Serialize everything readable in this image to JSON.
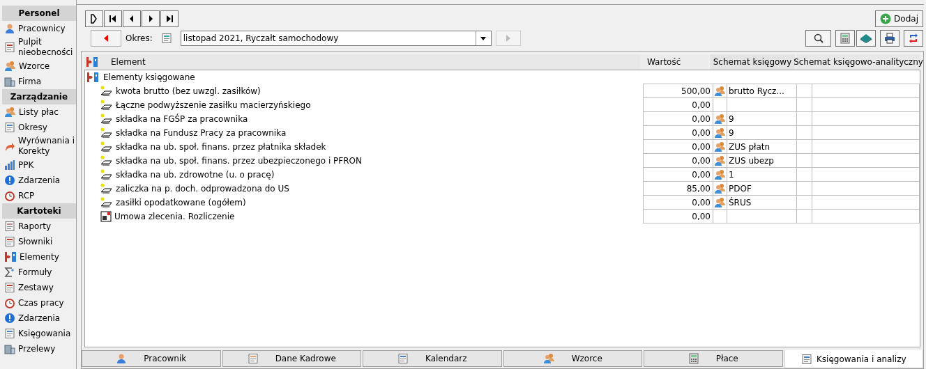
{
  "sidebar": [
    {
      "heading": "Personel",
      "items": [
        {
          "label": "Pracownicy"
        },
        {
          "label": "Pulpit nieobecności"
        },
        {
          "label": "Wzorce"
        },
        {
          "label": "Firma"
        }
      ]
    },
    {
      "heading": "Zarządzanie",
      "items": [
        {
          "label": "Listy płac"
        },
        {
          "label": "Okresy"
        },
        {
          "label": "Wyrównania i Korekty"
        },
        {
          "label": "PPK"
        },
        {
          "label": "Zdarzenia"
        },
        {
          "label": "RCP"
        }
      ]
    },
    {
      "heading": "Kartoteki",
      "items": [
        {
          "label": "Raporty"
        },
        {
          "label": "Słowniki"
        },
        {
          "label": "Elementy"
        },
        {
          "label": "Formuły"
        },
        {
          "label": "Zestawy"
        },
        {
          "label": "Czas pracy"
        },
        {
          "label": "Zdarzenia"
        },
        {
          "label": "Księgowania"
        },
        {
          "label": "Przelewy"
        }
      ]
    }
  ],
  "toolbar": {
    "period_label": "Okres:",
    "period_value": "listopad 2021, Ryczałt samochodowy",
    "add_button": "Dodaj"
  },
  "table": {
    "columns": [
      "Element",
      "Wartość",
      "Schemat księgowy",
      "Schemat księgowo-analityczny"
    ],
    "group": "Elementy księgowane",
    "rows": [
      {
        "kind": "element",
        "name": "kwota brutto (bez uwzgl. zasiłków)",
        "value": "500,00",
        "scheme": "brutto Rycz..."
      },
      {
        "kind": "element",
        "name": "Łączne podwyższenie zasiłku macierzyńskiego",
        "value": "0,00"
      },
      {
        "kind": "element",
        "name": "składka na FGŚP za pracownika",
        "value": "0,00",
        "scheme": "9"
      },
      {
        "kind": "element",
        "name": "składka na Fundusz Pracy za pracownika",
        "value": "0,00",
        "scheme": "9"
      },
      {
        "kind": "element",
        "name": "składka na ub. społ. finans. przez płatnika składek",
        "value": "0,00",
        "scheme": "ZUS płatn"
      },
      {
        "kind": "element",
        "name": "składka na ub. społ. finans. przez ubezpieczonego i PFRON",
        "value": "0,00",
        "scheme": "ZUS ubezp"
      },
      {
        "kind": "element",
        "name": "składka na ub. zdrowotne (u. o pracę)",
        "value": "0,00",
        "scheme": "1"
      },
      {
        "kind": "element",
        "name": "zaliczka na p. doch. odprowadzona do US",
        "value": "85,00",
        "scheme": "PDOF"
      },
      {
        "kind": "element",
        "name": "zasiłki opodatkowane (ogółem)",
        "value": "0,00",
        "scheme": "ŚRUS"
      },
      {
        "kind": "settlement",
        "name": "Umowa zlecenia. Rozliczenie",
        "value": "0,00"
      }
    ]
  },
  "tabs": [
    {
      "label": "Pracownik",
      "selected": false
    },
    {
      "label": "Dane Kadrowe",
      "selected": false
    },
    {
      "label": "Kalendarz",
      "selected": false
    },
    {
      "label": "Wzorce",
      "selected": false
    },
    {
      "label": "Płace",
      "selected": false
    },
    {
      "label": "Księgowania i analizy",
      "selected": true
    }
  ]
}
